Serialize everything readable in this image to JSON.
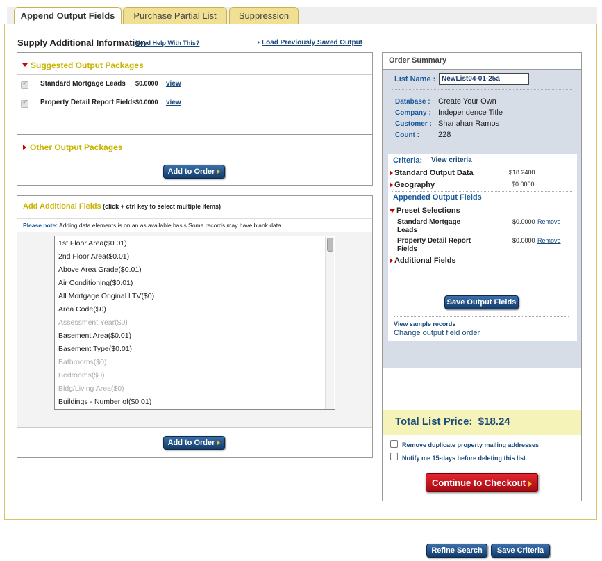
{
  "tabs": [
    {
      "label": "Append Output Fields"
    },
    {
      "label": "Purchase Partial List"
    },
    {
      "label": "Suppression"
    }
  ],
  "supply": {
    "title": "Supply Additional Information",
    "help_link": "Need Help With This?",
    "load_link": "Load Previously Saved Output"
  },
  "suggested": {
    "title": "Suggested Output Packages",
    "items": [
      {
        "label": "Standard Mortgage Leads",
        "price": "$0.0000",
        "view": "view"
      },
      {
        "label": "Property Detail Report Fields",
        "price": "$0.0000",
        "view": "view"
      }
    ]
  },
  "other": {
    "title": "Other Output Packages"
  },
  "add_to_order": "Add to Order",
  "additional": {
    "title": "Add Additional Fields",
    "hint": "(click + ctrl key to select multiple items)",
    "note_label": "Please note:",
    "note_text": "Adding data elements is on an as available basis.Some records may have blank data.",
    "fields": [
      {
        "label": "1st Floor Area($0.01)",
        "disabled": false
      },
      {
        "label": "2nd Floor Area($0.01)",
        "disabled": false
      },
      {
        "label": "Above Area Grade($0.01)",
        "disabled": false
      },
      {
        "label": "Air Conditioning($0.01)",
        "disabled": false
      },
      {
        "label": "All Mortgage Original LTV($0)",
        "disabled": false
      },
      {
        "label": "Area Code($0)",
        "disabled": false
      },
      {
        "label": "Assessment Year($0)",
        "disabled": true
      },
      {
        "label": "Basement Area($0.01)",
        "disabled": false
      },
      {
        "label": "Basement Type($0.01)",
        "disabled": false
      },
      {
        "label": "Bathrooms($0)",
        "disabled": true
      },
      {
        "label": "Bedrooms($0)",
        "disabled": true
      },
      {
        "label": "Bldg/Living Area($0)",
        "disabled": true
      },
      {
        "label": "Buildings - Number of($0.01)",
        "disabled": false
      }
    ]
  },
  "summary": {
    "title": "Order Summary",
    "list_name_label": "List Name :",
    "list_name_value": "NewList04-01-25a",
    "database_label": "Database :",
    "database_value": "Create Your Own",
    "company_label": "Company :",
    "company_value": "Independence Title",
    "customer_label": "Customer :",
    "customer_value": "Shanahan Ramos",
    "count_label": "Count :",
    "count_value": "228",
    "criteria_label": "Criteria:",
    "view_criteria": "View criteria",
    "standard_output_label": "Standard Output Data",
    "standard_output_price": "$18.2400",
    "geography_label": "Geography",
    "geography_price": "$0.0000",
    "appended_title": "Appended Output Fields",
    "preset_label": "Preset Selections",
    "preset_items": [
      {
        "label": "Standard Mortgage Leads",
        "price": "$0.0000",
        "remove": "Remove"
      },
      {
        "label": "Property Detail Report Fields",
        "price": "$0.0000",
        "remove": "Remove"
      }
    ],
    "additional_fields_label": "Additional Fields",
    "save_output_fields": "Save Output Fields",
    "view_sample": "View sample records",
    "change_order": "Change output field order",
    "total_label": "Total List Price:",
    "total_value": "$18.24",
    "remove_duplicates": "Remove duplicate property mailing addresses",
    "notify": "Notify me 15-days before deleting this list",
    "checkout": "Continue to Checkout"
  },
  "footer": {
    "refine": "Refine Search",
    "save_criteria": "Save Criteria"
  },
  "colors": {
    "accent_yellow": "#c8b400",
    "navy": "#1a4a7a",
    "checkout_red": "#c8101a",
    "total_bg": "#f6f3b8"
  }
}
